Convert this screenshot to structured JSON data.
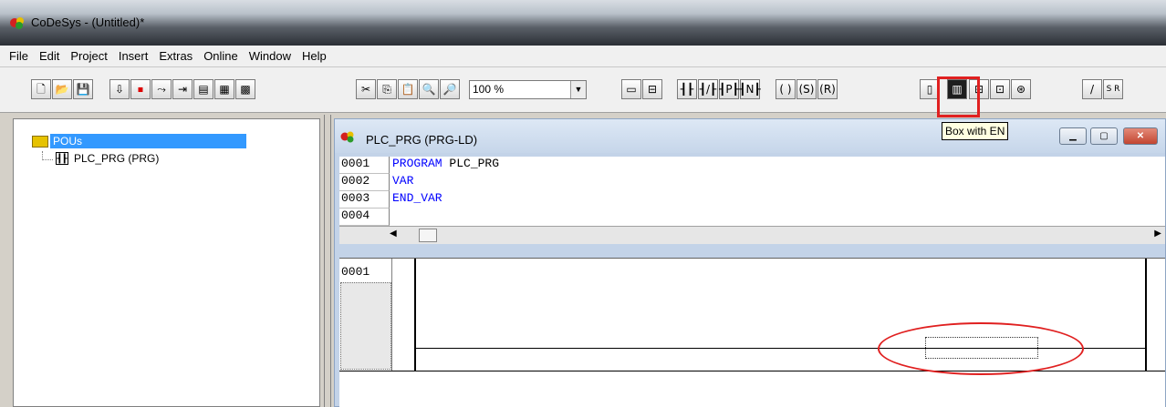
{
  "window": {
    "title": "CoDeSys - (Untitled)*"
  },
  "menu": [
    "File",
    "Edit",
    "Project",
    "Insert",
    "Extras",
    "Online",
    "Window",
    "Help"
  ],
  "toolbar": {
    "zoom_value": "100 %",
    "ld_contact_glyphs": [
      "┨┠",
      "┨/┠",
      "┨P┠",
      "┨N┠"
    ],
    "ld_coil_glyphs": [
      "( )",
      "(S)",
      "(R)"
    ],
    "line_glyph": "/",
    "sr_glyph": "S R"
  },
  "tooltip": "Box with EN",
  "pou_tree": {
    "root": "POUs",
    "items": [
      "PLC_PRG (PRG)"
    ]
  },
  "editor": {
    "title": "PLC_PRG (PRG-LD)",
    "declaration": [
      {
        "num": "0001",
        "code": "PROGRAM PLC_PRG"
      },
      {
        "num": "0002",
        "code": "VAR"
      },
      {
        "num": "0003",
        "code": "END_VAR"
      },
      {
        "num": "0004",
        "code": ""
      }
    ],
    "network_number": "0001"
  },
  "colors": {
    "selection": "#3399ff",
    "keyword": "#0000ff",
    "annotation": "#e02020",
    "tooltip_bg": "#ffffe1"
  }
}
